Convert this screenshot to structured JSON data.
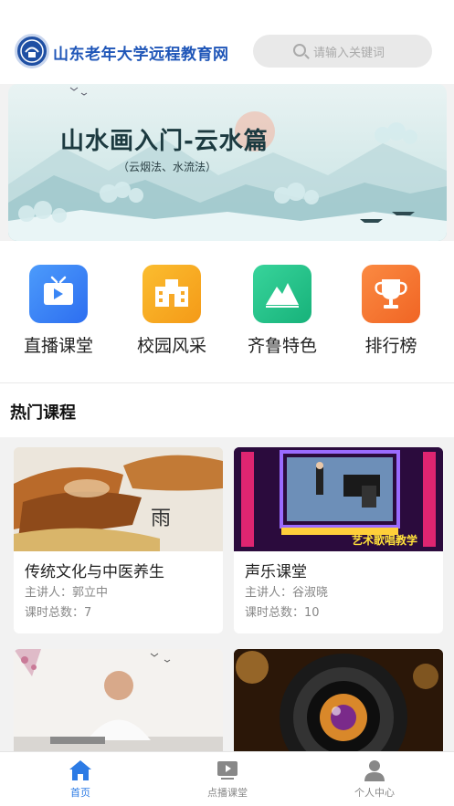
{
  "header": {
    "site_title": "山东老年大学远程教育网",
    "search_placeholder": "请输入关键词"
  },
  "banner": {
    "title": "山水画入门-云水篇",
    "subtitle": "（云烟法、水流法）",
    "slide_count": 3,
    "active_slide": 2
  },
  "nav": [
    {
      "label": "直播课堂",
      "icon": "tv-icon",
      "color": "#3a86f5"
    },
    {
      "label": "校园风采",
      "icon": "campus-building-icon",
      "color": "#f7a928"
    },
    {
      "label": "齐鲁特色",
      "icon": "mountain-icon",
      "color": "#27c48a"
    },
    {
      "label": "排行榜",
      "icon": "trophy-icon",
      "color": "#f57a33"
    }
  ],
  "section": {
    "title": "热门课程"
  },
  "courses": [
    {
      "title": "传统文化与中医养生",
      "teacher": "主讲人：郭立中",
      "lessons": "课时总数：7"
    },
    {
      "title": "声乐课堂",
      "teacher": "主讲人：谷淑晓",
      "lessons": "课时总数：10",
      "thumb_caption": "艺术歌唱教学"
    },
    {
      "title": "",
      "teacher": "",
      "lessons": ""
    },
    {
      "title": "",
      "teacher": "",
      "lessons": ""
    }
  ],
  "tabbar": {
    "active_color": "#2c7be5",
    "inactive_color": "#888888",
    "tabs": [
      {
        "label": "首页",
        "icon": "home-icon"
      },
      {
        "label": "点播课堂",
        "icon": "video-play-icon"
      },
      {
        "label": "个人中心",
        "icon": "person-icon"
      }
    ]
  }
}
